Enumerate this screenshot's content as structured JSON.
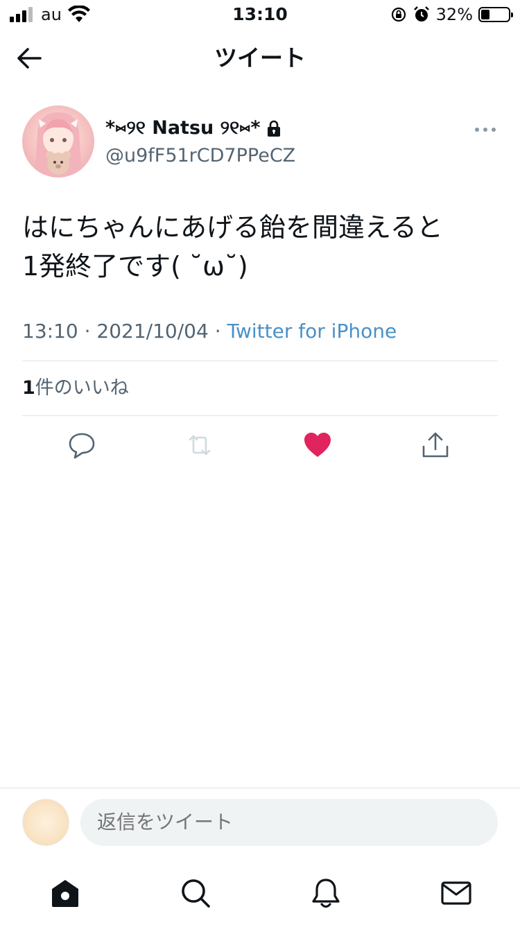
{
  "status_bar": {
    "carrier": "au",
    "time": "13:10",
    "battery_percent": "32%",
    "battery_level": 0.32,
    "icons": [
      "signal-icon",
      "wifi-icon",
      "orientation-lock-icon",
      "alarm-icon",
      "battery-icon"
    ]
  },
  "header": {
    "title": "ツイート",
    "back_icon": "back-arrow-icon"
  },
  "tweet": {
    "display_name": "*⑅୨୧ Natsu ୨୧⑅*",
    "protected": true,
    "handle": "@u9fF51rCD7PPeCZ",
    "text": "はにちゃんにあげる飴を間違えると\n1発終了です( ˘ω˘)",
    "time": "13:10",
    "separator": "·",
    "date": "2021/10/04",
    "source": "Twitter for iPhone",
    "like_count": "1",
    "like_label": "件のいいね",
    "liked": true
  },
  "actions": [
    {
      "name": "reply",
      "icon": "reply-icon"
    },
    {
      "name": "retweet",
      "icon": "retweet-icon"
    },
    {
      "name": "like",
      "icon": "heart-icon"
    },
    {
      "name": "share",
      "icon": "share-icon"
    }
  ],
  "reply": {
    "placeholder": "返信をツイート"
  },
  "bottom_nav": [
    {
      "name": "home",
      "icon": "home-icon"
    },
    {
      "name": "search",
      "icon": "search-icon"
    },
    {
      "name": "notifications",
      "icon": "bell-icon"
    },
    {
      "name": "messages",
      "icon": "mail-icon"
    }
  ],
  "colors": {
    "accent_link": "#4a90c8",
    "like_red": "#e0245e",
    "secondary_text": "#536471",
    "divider": "#dfe3e6",
    "retweet_disabled": "#cfd9de"
  }
}
